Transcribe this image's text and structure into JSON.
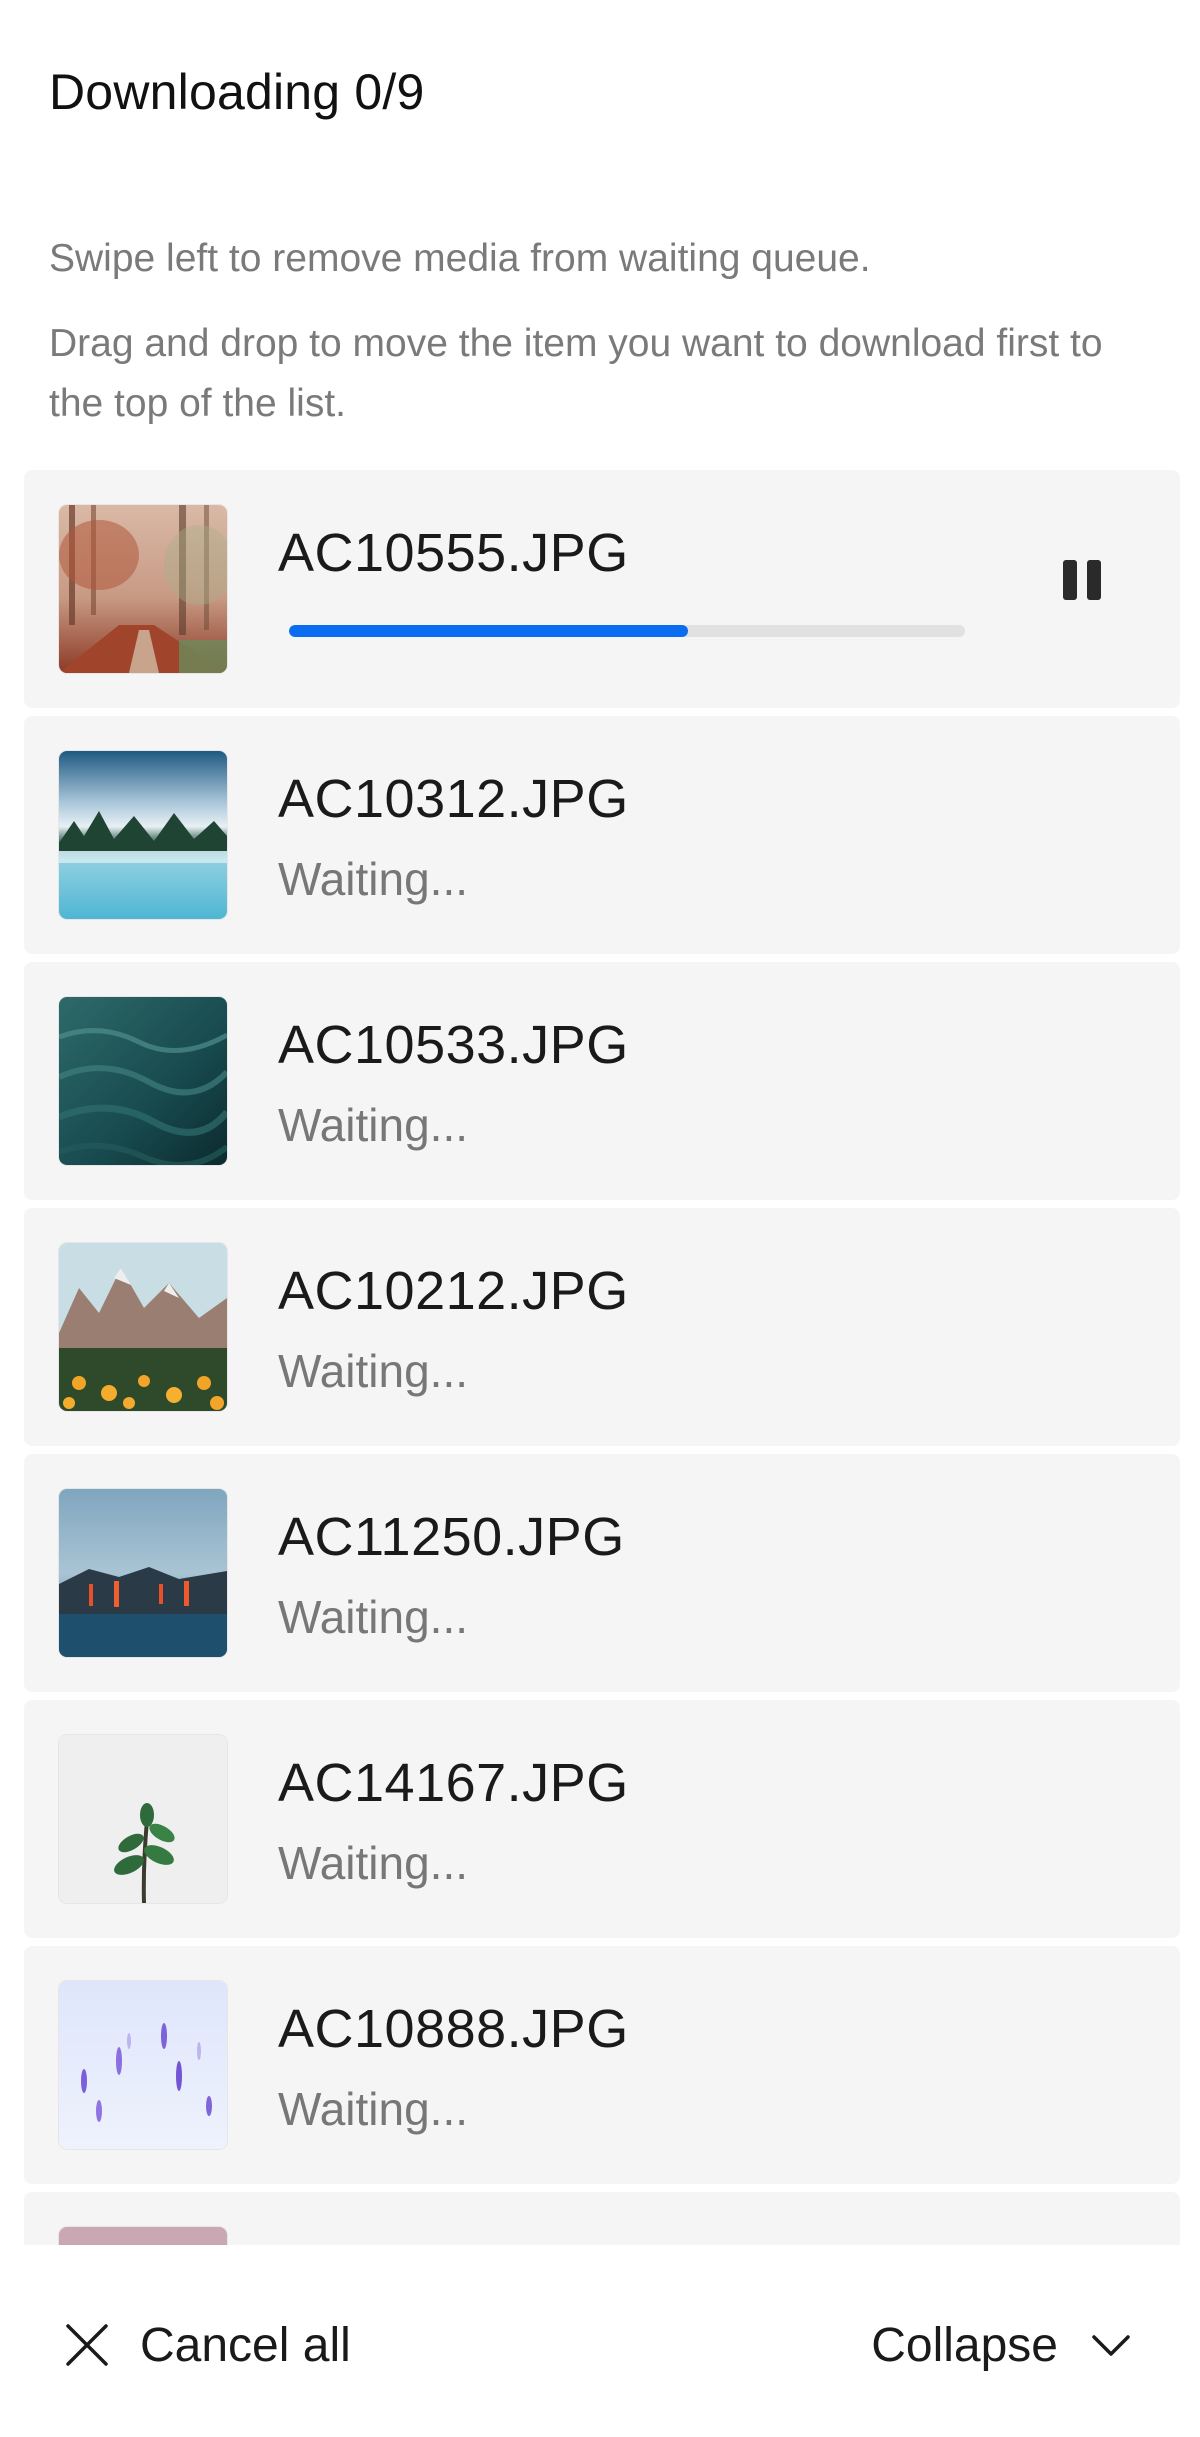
{
  "header": {
    "title": "Downloading 0/9",
    "hint_swipe": "Swipe left to remove media from waiting queue.",
    "hint_drag": "Drag and drop to move the item you want to download first to the top of the list."
  },
  "queue": {
    "items": [
      {
        "filename": "AC10555.JPG",
        "status": "",
        "progress": 0.59,
        "thumb": "foggy-forest-path"
      },
      {
        "filename": "AC10312.JPG",
        "status": "Waiting...",
        "thumb": "misty-lake"
      },
      {
        "filename": "AC10533.JPG",
        "status": "Waiting...",
        "thumb": "ocean-waves"
      },
      {
        "filename": "AC10212.JPG",
        "status": "Waiting...",
        "thumb": "mountain-flowers"
      },
      {
        "filename": "AC11250.JPG",
        "status": "Waiting...",
        "thumb": "lava-coast"
      },
      {
        "filename": "AC14167.JPG",
        "status": "Waiting...",
        "thumb": "plant-sprout"
      },
      {
        "filename": "AC10888.JPG",
        "status": "Waiting...",
        "thumb": "purple-flowers-snow"
      }
    ]
  },
  "footer": {
    "cancel_label": "Cancel all",
    "collapse_label": "Collapse"
  },
  "icons": {
    "pause": "pause-icon",
    "cancel": "close-icon",
    "collapse": "chevron-down-icon"
  },
  "colors": {
    "progress_fill": "#0a6cf1",
    "progress_track": "#e1e1e1",
    "row_background": "#f5f5f5"
  }
}
